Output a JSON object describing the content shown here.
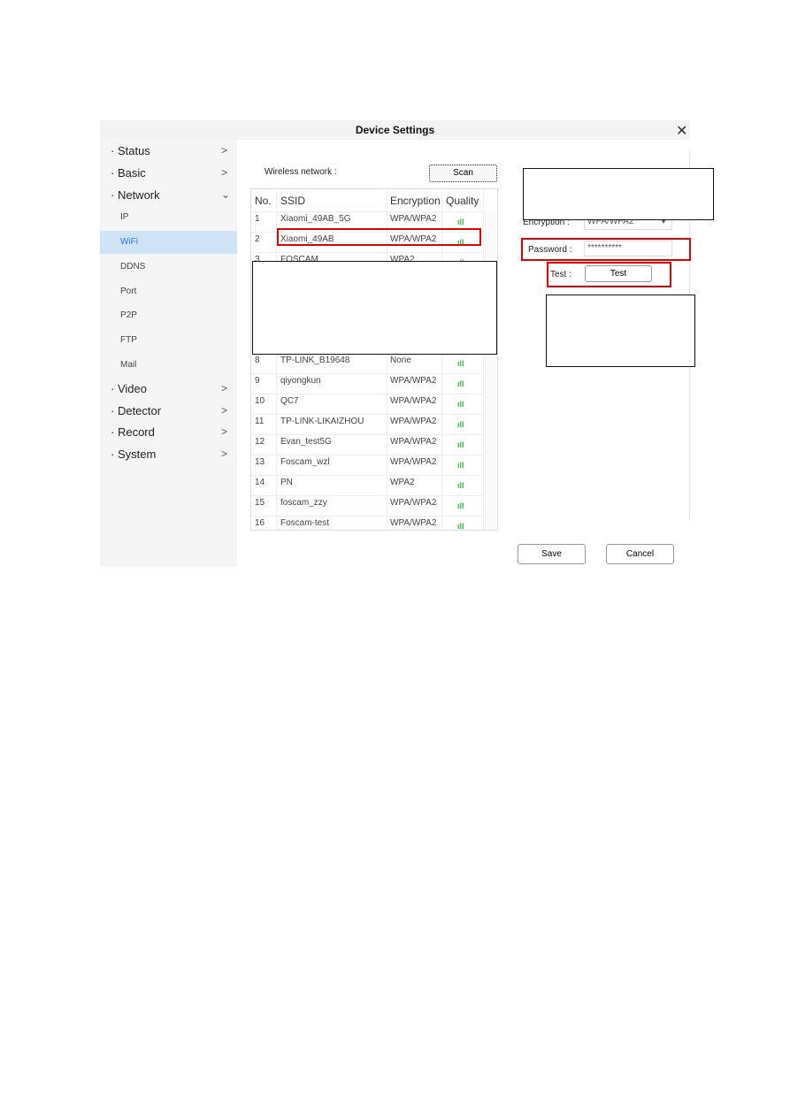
{
  "window": {
    "title": "Device Settings",
    "close_icon": "close-icon"
  },
  "sidebar": {
    "menus": [
      {
        "label": "Status"
      },
      {
        "label": "Basic"
      },
      {
        "label": "Network",
        "expanded": true
      },
      {
        "label": "Video"
      },
      {
        "label": "Detector"
      },
      {
        "label": "Record"
      },
      {
        "label": "System"
      }
    ],
    "network_sub": [
      {
        "label": "IP"
      },
      {
        "label": "WiFi",
        "active": true
      },
      {
        "label": "DDNS"
      },
      {
        "label": "Port"
      },
      {
        "label": "P2P"
      },
      {
        "label": "FTP"
      },
      {
        "label": "Mail"
      }
    ]
  },
  "wifi": {
    "wireless_label": "Wireless network :",
    "scan_label": "Scan",
    "columns": [
      "No.",
      "SSID",
      "Encryption",
      "Quality"
    ],
    "rows": [
      {
        "no": "1",
        "ssid": "Xiaomi_49AB_5G",
        "enc": "WPA/WPA2"
      },
      {
        "no": "2",
        "ssid": "Xiaomi_49AB",
        "enc": "WPA/WPA2"
      },
      {
        "no": "3",
        "ssid": "FOSCAM",
        "enc": "WPA2"
      },
      {
        "no": "8",
        "ssid": "TP-LINK_B19648",
        "enc": "None"
      },
      {
        "no": "9",
        "ssid": "qiyongkun",
        "enc": "WPA/WPA2"
      },
      {
        "no": "10",
        "ssid": "QC7",
        "enc": "WPA/WPA2"
      },
      {
        "no": "11",
        "ssid": "TP-LINK-LIKAIZHOU",
        "enc": "WPA/WPA2"
      },
      {
        "no": "12",
        "ssid": "Evan_test5G",
        "enc": "WPA/WPA2"
      },
      {
        "no": "13",
        "ssid": "Foscam_wzl",
        "enc": "WPA/WPA2"
      },
      {
        "no": "14",
        "ssid": "PN",
        "enc": "WPA2"
      },
      {
        "no": "15",
        "ssid": "foscam_zzy",
        "enc": "WPA/WPA2"
      },
      {
        "no": "16",
        "ssid": "Foscam-test",
        "enc": "WPA/WPA2"
      }
    ],
    "signal_glyph": "ıll",
    "signal_color": "#3bb54a",
    "encryption_label": "Encryption :",
    "encryption_value": "WPA/WPA2",
    "password_label": "Password :",
    "password_value": "**********",
    "test_label": "Test :",
    "test_button": "Test",
    "save": "Save",
    "cancel": "Cancel"
  },
  "colors": {
    "highlight": "#e00000",
    "active": "#2a7ad0"
  }
}
